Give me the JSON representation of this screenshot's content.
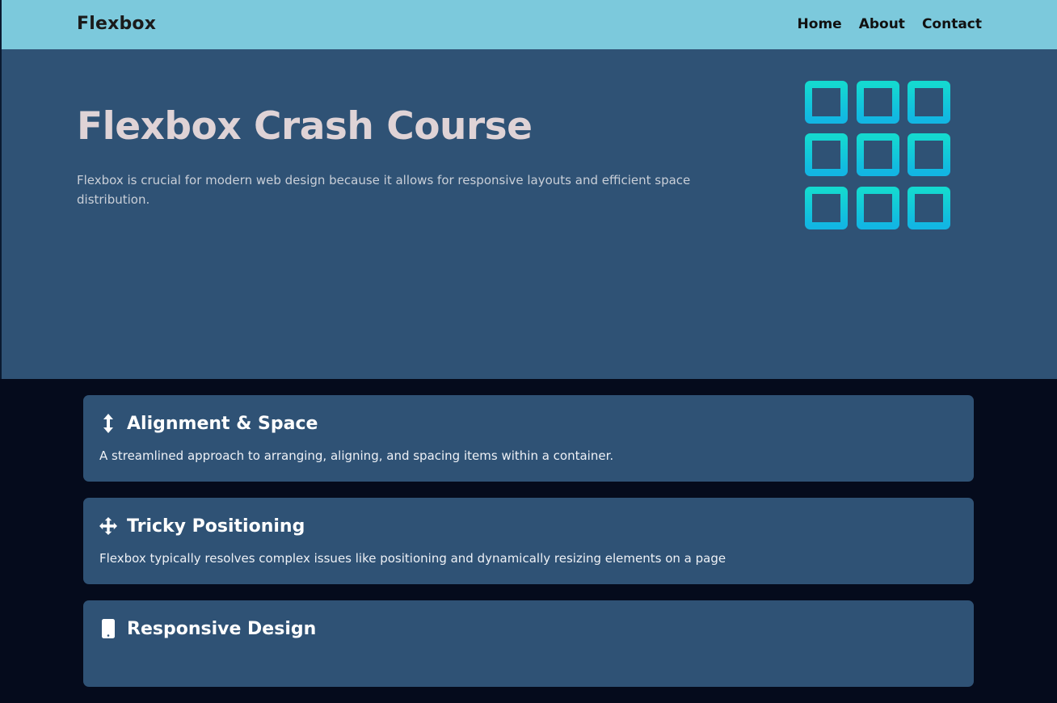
{
  "navbar": {
    "brand": "Flexbox",
    "links": [
      "Home",
      "About",
      "Contact"
    ]
  },
  "hero": {
    "title": "Flexbox Crash Course",
    "text": "Flexbox is crucial for modern web design because it allows for responsive layouts and efficient space distribution.",
    "logo_icon": "grid-3x3-icon",
    "logo_gradient": [
      "#14d9d0",
      "#12b6e3"
    ]
  },
  "features": [
    {
      "icon": "vertical-arrows-icon",
      "title": "Alignment & Space",
      "text": "A streamlined approach to arranging, aligning, and spacing items within a container."
    },
    {
      "icon": "move-arrows-icon",
      "title": "Tricky Positioning",
      "text": "Flexbox typically resolves complex issues like positioning and dynamically resizing elements on a page"
    },
    {
      "icon": "mobile-phone-icon",
      "title": "Responsive Design",
      "text": ""
    }
  ],
  "colors": {
    "navbar_bg": "#7cc9dc",
    "hero_bg": "#2f5275",
    "page_bg": "#050b1c",
    "card_bg": "#2f5275",
    "hero_title": "#dfd3d6"
  }
}
